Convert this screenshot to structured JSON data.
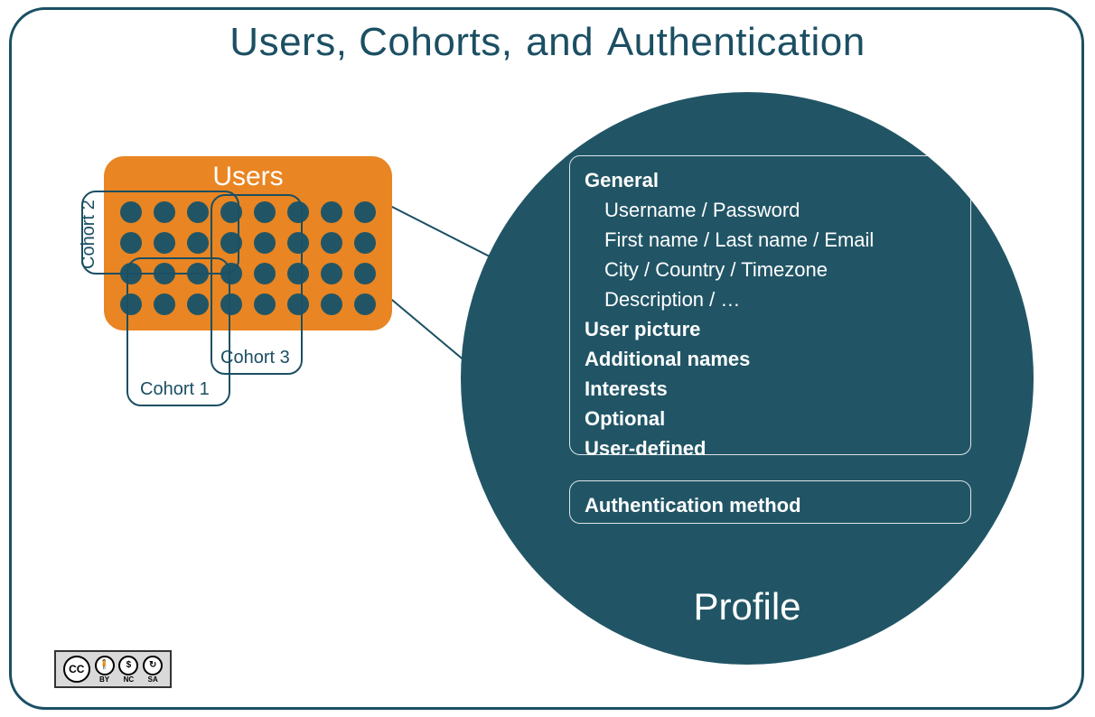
{
  "title_part1": "Users, Cohorts,",
  "title_and": "and",
  "title_part2": "Authentication",
  "users_label": "Users",
  "cohorts": {
    "c1": "Cohort 1",
    "c2": "Cohort 2",
    "c3": "Cohort 3"
  },
  "profile": {
    "title": "Profile",
    "sections": {
      "general": "General",
      "general_items": {
        "i1": "Username / Password",
        "i2": "First name / Last name / Email",
        "i3": "City / Country / Timezone",
        "i4": "Description / …"
      },
      "user_picture": "User picture",
      "additional_names": "Additional names",
      "interests": "Interests",
      "optional": "Optional",
      "user_defined": "User-defined"
    },
    "auth_method": "Authentication method"
  },
  "license": {
    "cc": "CC",
    "by": "BY",
    "nc": "NC",
    "sa": "SA",
    "by_sym": "🧍",
    "nc_sym": "$",
    "sa_sym": "↻"
  },
  "colors": {
    "frame": "#1b4f63",
    "orange": "#e98522",
    "circle": "#215566"
  }
}
